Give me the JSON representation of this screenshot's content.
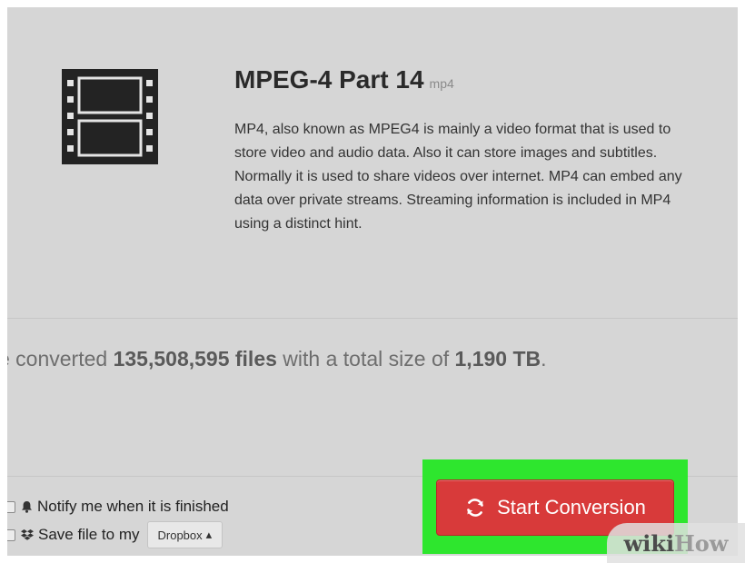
{
  "format": {
    "title": "MPEG-4 Part 14",
    "extension": "mp4",
    "icon": "film-icon",
    "description": "MP4, also known as MPEG4 is mainly a video format that is used to store video and audio data. Also it can store images and subtitles. Normally it is used to share videos over internet. MP4 can embed any data over private streams. Streaming information is included in MP4 using a distinct hint."
  },
  "stats": {
    "prefix": "e converted ",
    "files_count": "135,508,595 files",
    "middle": " with a total size of ",
    "total_size": "1,190 TB",
    "suffix": "."
  },
  "options": {
    "notify": {
      "label": "Notify me when it is finished",
      "icon": "bell-icon",
      "checked": false
    },
    "save": {
      "label": "Save file to my",
      "icon": "dropbox-icon",
      "checked": false
    },
    "dropbox_button": "Dropbox",
    "dropbox_arrow": "▴"
  },
  "action": {
    "start_label": "Start Conversion",
    "icon": "refresh-icon",
    "button_color": "#d83a3a",
    "highlight_color": "#2ee62e"
  },
  "watermark": {
    "part1": "wiki",
    "part2": "How"
  }
}
